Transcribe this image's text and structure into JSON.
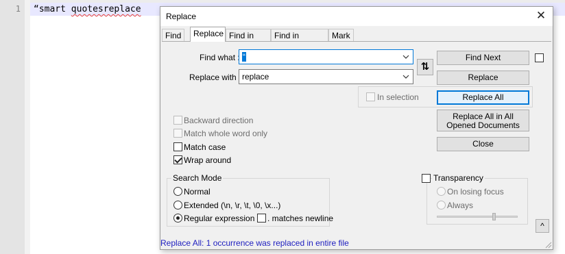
{
  "editor": {
    "line_number": "1",
    "text_before": "“smart ",
    "text_misspelled": "quotesreplace"
  },
  "dialog": {
    "title": "Replace",
    "close_glyph": "✕",
    "tabs": [
      {
        "label": "Find"
      },
      {
        "label": "Replace"
      },
      {
        "label": "Find in Files"
      },
      {
        "label": "Find in Projects"
      },
      {
        "label": "Mark"
      }
    ],
    "active_tab": "Replace",
    "find_label": "Find what :",
    "find_value": "“",
    "replace_label": "Replace with :",
    "replace_value": "replace",
    "swap_glyph": "⇅",
    "buttons": {
      "find_next": "Find Next",
      "replace": "Replace",
      "replace_all": "Replace All",
      "replace_all_opened": "Replace All in All Opened Documents",
      "close": "Close"
    },
    "in_selection": "In selection",
    "options": {
      "backward": "Backward direction",
      "whole_word": "Match whole word only",
      "match_case": "Match case",
      "wrap_around": "Wrap around"
    },
    "search_mode": {
      "title": "Search Mode",
      "normal": "Normal",
      "extended": "Extended (\\n, \\r, \\t, \\0, \\x...)",
      "regex": "Regular expression",
      "dot_newline": ". matches newline"
    },
    "transparency": {
      "title": "Transparency",
      "on_losing_focus": "On losing focus",
      "always": "Always"
    },
    "collapse_glyph": "^",
    "status": "Replace All: 1 occurrence was replaced in entire file"
  },
  "colors": {
    "status_text": "#1c1cbf",
    "accent": "#0078d7",
    "current_line": "#e8e8ff"
  }
}
